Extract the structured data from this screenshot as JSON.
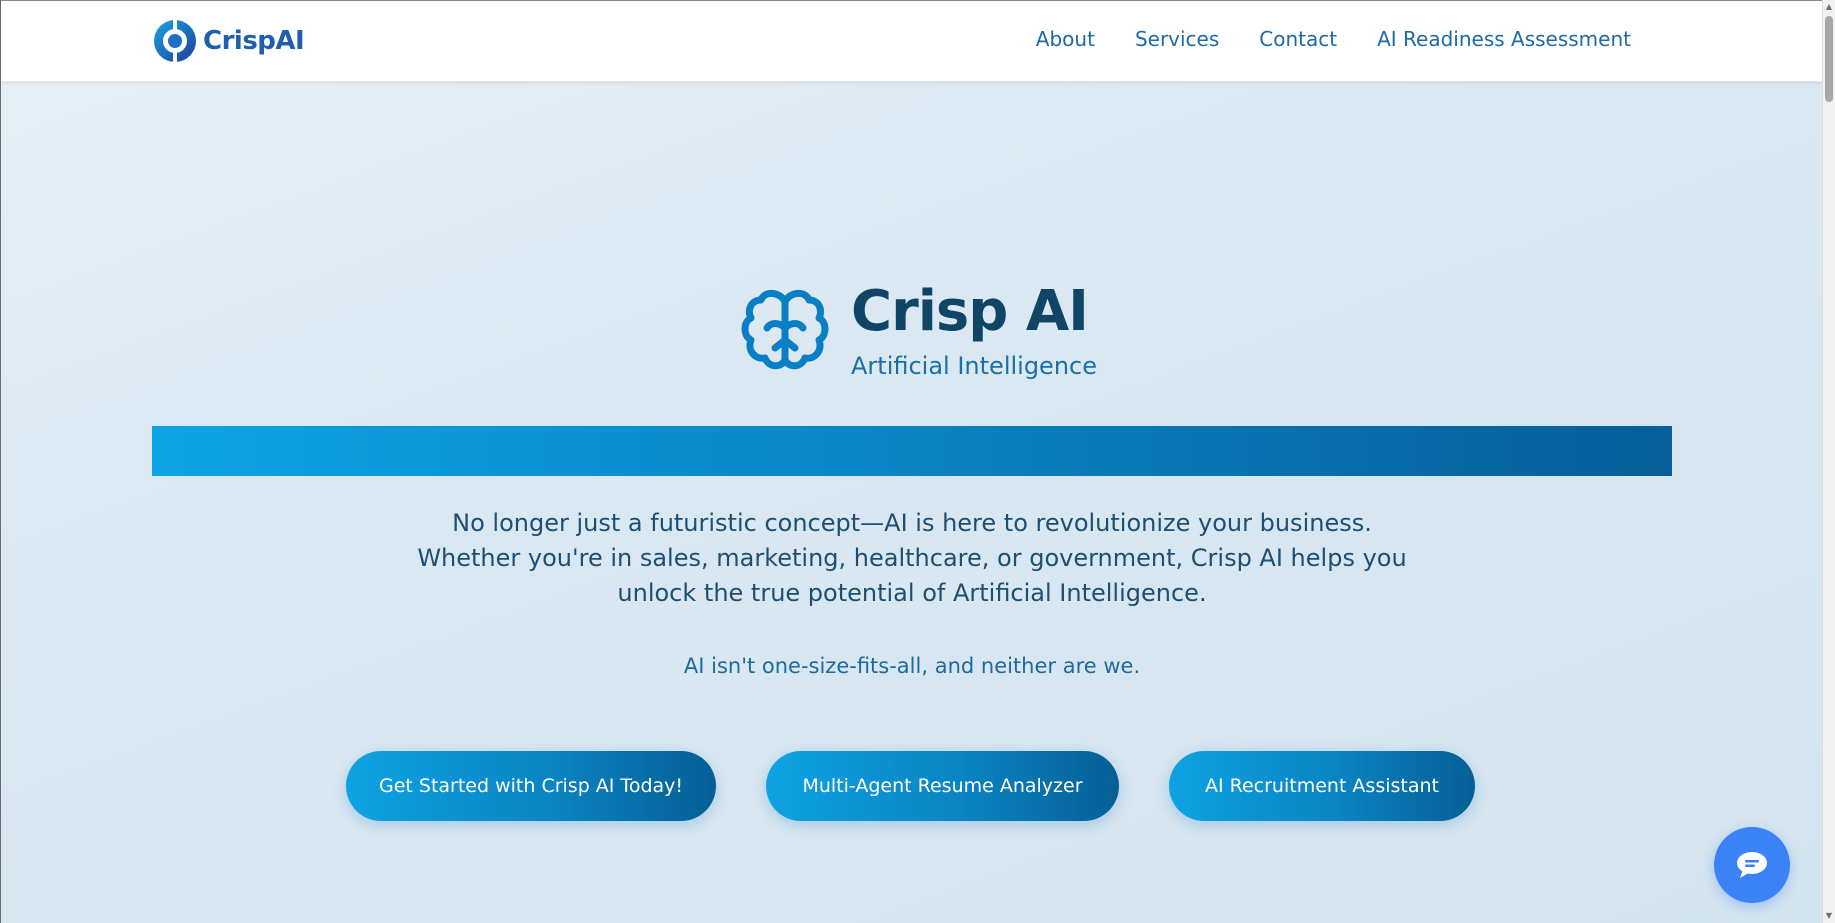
{
  "header": {
    "logo_text": "CrispAI",
    "nav": [
      {
        "label": "About"
      },
      {
        "label": "Services"
      },
      {
        "label": "Contact"
      },
      {
        "label": "AI Readiness Assessment"
      }
    ]
  },
  "hero": {
    "title": "Crisp AI",
    "subtitle": "Artificial Intelligence",
    "description": "No longer just a futuristic concept—AI is here to revolutionize your business. Whether you're in sales, marketing, healthcare, or government, Crisp AI helps you unlock the true potential of Artificial Intelligence.",
    "tagline": "AI isn't one-size-fits-all, and neither are we.",
    "buttons": [
      {
        "label": "Get Started with Crisp AI Today!"
      },
      {
        "label": "Multi-Agent Resume Analyzer"
      },
      {
        "label": "AI Recruitment Assistant"
      }
    ]
  },
  "colors": {
    "brand_dark": "#0f4565",
    "brand_blue": "#1a6fa8",
    "gradient_start": "#0ea4e6",
    "gradient_end": "#065f99",
    "chat_button": "#3b82f6"
  },
  "icons": {
    "logo": "crispai-logo-icon",
    "hero": "brain-icon",
    "chat": "chat-bubble-icon"
  }
}
